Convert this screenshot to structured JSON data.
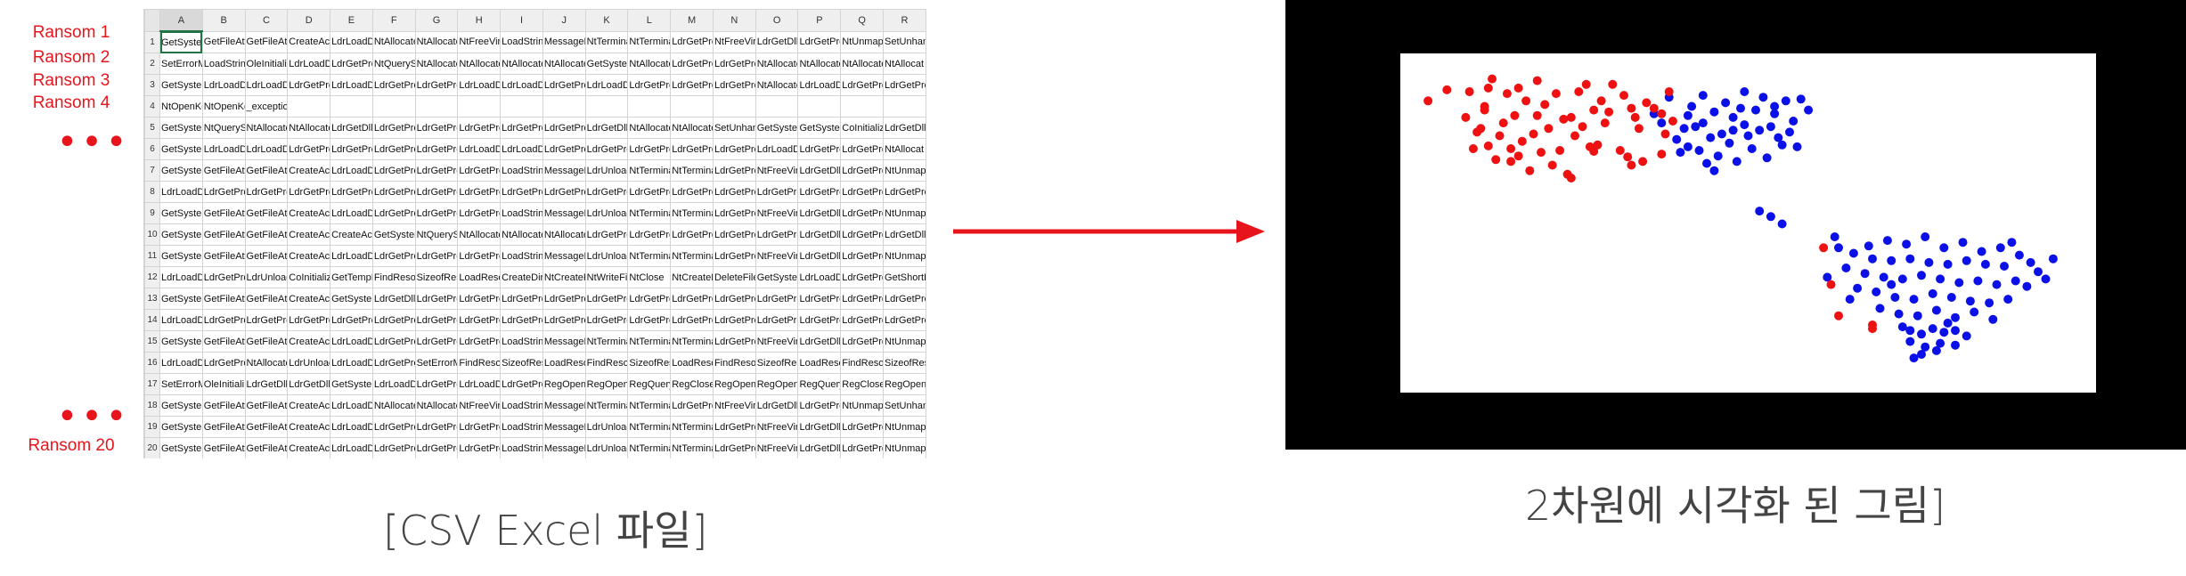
{
  "labels": {
    "ransom1": "Ransom 1",
    "ransom2": "Ransom 2",
    "ransom3": "Ransom 3",
    "ransom4": "Ransom 4",
    "ransom20": "Ransom 20",
    "ellipsis": "•••"
  },
  "spreadsheet": {
    "columns": [
      "A",
      "B",
      "C",
      "D",
      "E",
      "F",
      "G",
      "H",
      "I",
      "J",
      "K",
      "L",
      "M",
      "N",
      "O",
      "P",
      "Q",
      "R"
    ],
    "rows": [
      {
        "n": "1",
        "cells": [
          "GetSystem",
          "GetFileAtt",
          "GetFileAtt",
          "CreateActi",
          "LdrLoadDl",
          "NtAllocate",
          "NtAllocate",
          "NtFreeVirt",
          "LoadString",
          "MessageB",
          "NtTermina",
          "NtTermina",
          "LdrGetPro",
          "NtFreeVirt",
          "LdrGetDllI",
          "LdrGetPro",
          "NtUnmapV",
          "SetUnhan"
        ]
      },
      {
        "n": "2",
        "cells": [
          "SetErrorM",
          "LoadString",
          "OleInitiali",
          "LdrLoadDl",
          "LdrGetPro",
          "NtQuerySy",
          "NtAllocate",
          "NtAllocate",
          "NtAllocate",
          "NtAllocate",
          "GetSystem",
          "NtAllocate",
          "LdrGetPro",
          "LdrGetPro",
          "NtAllocate",
          "NtAllocate",
          "NtAllocate",
          "NtAllocat"
        ]
      },
      {
        "n": "3",
        "cells": [
          "GetSystem",
          "LdrLoadDl",
          "LdrLoadDl",
          "LdrGetPro",
          "LdrLoadDl",
          "LdrGetPro",
          "LdrGetPro",
          "LdrLoadDl",
          "LdrLoadDl",
          "LdrGetPro",
          "LdrLoadDl",
          "LdrGetPro",
          "LdrGetPro",
          "LdrGetPro",
          "NtAllocate",
          "LdrLoadDl",
          "LdrGetPro",
          "LdrGetPro"
        ]
      },
      {
        "n": "4",
        "cells": [
          "NtOpenKe",
          "NtOpenKe",
          "_exception_",
          "",
          "",
          "",
          "",
          "",
          "",
          "",
          "",
          "",
          "",
          "",
          "",
          "",
          "",
          ""
        ]
      },
      {
        "n": "5",
        "cells": [
          "GetSystem",
          "NtQuerySy",
          "NtAllocate",
          "NtAllocate",
          "LdrGetDllI",
          "LdrGetPro",
          "LdrGetPro",
          "LdrGetPro",
          "LdrGetPro",
          "LdrGetPro",
          "LdrGetDllI",
          "NtAllocate",
          "NtAllocate",
          "SetUnhan",
          "GetSystem",
          "GetSystem",
          "CoInitializ",
          "LdrGetDllI"
        ]
      },
      {
        "n": "6",
        "cells": [
          "GetSystem",
          "LdrLoadDl",
          "LdrLoadDl",
          "LdrGetPro",
          "LdrGetPro",
          "LdrGetPro",
          "LdrGetPro",
          "LdrLoadDl",
          "LdrLoadDl",
          "LdrGetPro",
          "LdrGetPro",
          "LdrGetPro",
          "LdrGetPro",
          "LdrGetPro",
          "LdrLoadDl",
          "LdrGetPro",
          "LdrGetPro",
          "NtAllocat"
        ]
      },
      {
        "n": "7",
        "cells": [
          "GetSystem",
          "GetFileAtt",
          "GetFileAtt",
          "CreateActi",
          "LdrLoadDl",
          "LdrGetPro",
          "LdrGetPro",
          "LdrGetPro",
          "LoadString",
          "MessageB",
          "LdrUnloac",
          "NtTermina",
          "NtTermina",
          "LdrGetPro",
          "NtFreeVirt",
          "LdrGetDllI",
          "LdrGetPro",
          "NtUnmap"
        ]
      },
      {
        "n": "8",
        "cells": [
          "LdrLoadDl",
          "LdrGetPro",
          "LdrGetPro",
          "LdrGetPro",
          "LdrGetPro",
          "LdrGetPro",
          "LdrGetPro",
          "LdrGetPro",
          "LdrGetPro",
          "LdrGetPro",
          "LdrGetPro",
          "LdrGetPro",
          "LdrGetPro",
          "LdrGetPro",
          "LdrGetPro",
          "LdrGetPro",
          "LdrGetPro",
          "LdrGetPro"
        ]
      },
      {
        "n": "9",
        "cells": [
          "GetSystem",
          "GetFileAtt",
          "GetFileAtt",
          "CreateActi",
          "LdrLoadDl",
          "LdrGetPro",
          "LdrGetPro",
          "LdrGetPro",
          "LoadString",
          "MessageB",
          "LdrUnloac",
          "NtTermina",
          "NtTermina",
          "LdrGetPro",
          "NtFreeVirt",
          "LdrGetDllI",
          "LdrGetPro",
          "NtUnmap"
        ]
      },
      {
        "n": "10",
        "cells": [
          "GetSystem",
          "GetFileAtt",
          "GetFileAtt",
          "CreateActi",
          "CreateActi",
          "GetSystem",
          "NtQuerySy",
          "NtAllocate",
          "NtAllocate",
          "NtAllocate",
          "LdrGetPro",
          "LdrGetPro",
          "LdrGetPro",
          "LdrGetPro",
          "LdrGetPro",
          "LdrGetDllI",
          "LdrGetPro",
          "LdrGetDllI"
        ]
      },
      {
        "n": "11",
        "cells": [
          "GetSystem",
          "GetFileAtt",
          "GetFileAtt",
          "CreateActi",
          "LdrLoadDl",
          "LdrGetPro",
          "LdrGetPro",
          "LdrGetPro",
          "LoadString",
          "MessageB",
          "LdrUnloac",
          "NtTermina",
          "NtTermina",
          "LdrGetPro",
          "NtFreeVirt",
          "LdrGetDllI",
          "LdrGetPro",
          "NtUnmap"
        ]
      },
      {
        "n": "12",
        "cells": [
          "LdrLoadDl",
          "LdrGetPro",
          "LdrUnloac",
          "CoInitializ",
          "GetTempF",
          "FindResou",
          "SizeofResc",
          "LoadResou",
          "CreateDire",
          "NtCreateF",
          "NtWriteFil",
          "NtClose",
          "NtCreateF",
          "DeleteFile",
          "GetSystem",
          "LdrLoadDl",
          "LdrGetPro",
          "GetShortI"
        ]
      },
      {
        "n": "13",
        "cells": [
          "GetSystem",
          "GetFileAtt",
          "GetFileAtt",
          "CreateActi",
          "GetSystem",
          "LdrGetDllI",
          "LdrGetPro",
          "LdrGetPro",
          "LdrGetPro",
          "LdrGetPro",
          "LdrGetPro",
          "LdrGetPro",
          "LdrGetPro",
          "LdrGetPro",
          "LdrGetPro",
          "LdrGetPro",
          "LdrGetPro",
          "LdrGetPro"
        ]
      },
      {
        "n": "14",
        "cells": [
          "LdrLoadDl",
          "LdrGetPro",
          "LdrGetPro",
          "LdrGetPro",
          "LdrGetPro",
          "LdrGetPro",
          "LdrGetPro",
          "LdrGetPro",
          "LdrGetPro",
          "LdrGetPro",
          "LdrGetPro",
          "LdrGetPro",
          "LdrGetPro",
          "LdrGetPro",
          "LdrGetPro",
          "LdrGetPro",
          "LdrGetPro",
          "LdrGetPro"
        ]
      },
      {
        "n": "15",
        "cells": [
          "GetSystem",
          "GetFileAtt",
          "GetFileAtt",
          "CreateActi",
          "LdrLoadDl",
          "LdrGetPro",
          "LdrGetPro",
          "LdrGetPro",
          "LoadString",
          "MessageB",
          "NtTermina",
          "NtTermina",
          "NtTermina",
          "LdrGetPro",
          "NtFreeVirt",
          "LdrGetDllI",
          "LdrGetPro",
          "NtUnmap"
        ]
      },
      {
        "n": "16",
        "cells": [
          "LdrLoadDl",
          "LdrGetPro",
          "NtAllocate",
          "LdrUnloac",
          "LdrLoadDl",
          "LdrGetPro",
          "SetErrorM",
          "FindResou",
          "SizeofResc",
          "LoadResou",
          "FindResou",
          "SizeofResc",
          "LoadResou",
          "FindResou",
          "SizeofResc",
          "LoadResou",
          "FindResou",
          "SizeofRes"
        ]
      },
      {
        "n": "17",
        "cells": [
          "SetErrorM",
          "OleInitiali",
          "LdrGetDllI",
          "LdrGetDllI",
          "GetSystem",
          "LdrLoadDl",
          "LdrGetPro",
          "LdrLoadDl",
          "LdrGetPro",
          "RegOpenK",
          "RegOpenK",
          "RegQuery",
          "RegCloseK",
          "RegOpenK",
          "RegOpenK",
          "RegQuery",
          "RegCloseK",
          "RegOpen"
        ]
      },
      {
        "n": "18",
        "cells": [
          "GetSystem",
          "GetFileAtt",
          "GetFileAtt",
          "CreateActi",
          "LdrLoadDl",
          "NtAllocate",
          "NtAllocate",
          "NtFreeVirt",
          "LoadString",
          "MessageB",
          "NtTermina",
          "NtTermina",
          "LdrGetPro",
          "NtFreeVirt",
          "LdrGetDllI",
          "LdrGetPro",
          "NtUnmapV",
          "SetUnhan"
        ]
      },
      {
        "n": "19",
        "cells": [
          "GetSystem",
          "GetFileAtt",
          "GetFileAtt",
          "CreateActi",
          "LdrLoadDl",
          "LdrGetPro",
          "LdrGetPro",
          "LdrGetPro",
          "LoadString",
          "MessageB",
          "LdrUnloac",
          "NtTermina",
          "NtTermina",
          "LdrGetPro",
          "NtFreeVirt",
          "LdrGetDllI",
          "LdrGetPro",
          "NtUnmap"
        ]
      },
      {
        "n": "20",
        "cells": [
          "GetSystem",
          "GetFileAtt",
          "GetFileAtt",
          "CreateActi",
          "LdrLoadDl",
          "LdrGetPro",
          "LdrGetPro",
          "LdrGetPro",
          "LoadString",
          "MessageB",
          "LdrUnloac",
          "NtTermina",
          "NtTermina",
          "LdrGetPro",
          "NtFreeVirt",
          "LdrGetDllI",
          "LdrGetPro",
          "NtUnmap"
        ]
      }
    ]
  },
  "captions": {
    "left": "[CSV Excel 파일]",
    "right": "2차원에 시각화 된 그림]"
  },
  "colors": {
    "label_red": "#e8141b",
    "arrow_red": "#e8141b",
    "point_red": "#ee1111",
    "point_blue": "#0a10e6",
    "plot_frame": "#000000"
  },
  "scatter": {
    "red": [
      [
        2,
        -0.2
      ],
      [
        6,
        -0.05
      ],
      [
        5,
        2.1
      ],
      [
        12,
        -0.9
      ],
      [
        8,
        -0.8
      ],
      [
        19,
        1.6
      ],
      [
        28,
        1.5
      ],
      [
        33,
        -0.1
      ],
      [
        44,
        -1.1
      ],
      [
        53,
        0.6
      ],
      [
        44,
        2.0
      ],
      [
        54,
        2.9
      ],
      [
        39,
        3.3
      ],
      [
        24,
        2.8
      ],
      [
        14,
        -0.6
      ],
      [
        16,
        2.4
      ],
      [
        36,
        2.4
      ],
      [
        48,
        2.3
      ],
      [
        55,
        1.3
      ],
      [
        34,
        -0.35
      ],
      [
        26,
        1.4
      ],
      [
        14,
        3.1
      ],
      [
        43,
        -0.65
      ],
      [
        29,
        0.5
      ],
      [
        38,
        1.8
      ],
      [
        10,
        1.2
      ],
      [
        20,
        -0.4
      ],
      [
        5,
        1.9
      ],
      [
        30,
        2.9
      ],
      [
        22,
        0.9
      ],
      [
        52,
        -0.5
      ],
      [
        27,
        -1.6
      ],
      [
        9,
        0.5
      ],
      [
        15,
        0.2
      ],
      [
        46,
        0.9
      ],
      [
        35,
        0.0
      ],
      [
        41,
        -0.3
      ],
      [
        17,
        -1.4
      ],
      [
        31,
        1.0
      ],
      [
        50,
        2.0
      ],
      [
        1,
        2.9
      ],
      [
        7,
        3.6
      ],
      [
        12,
        -0.2
      ],
      [
        25,
        -0.3
      ],
      [
        3,
        0.7
      ],
      [
        21,
        2.2
      ],
      [
        19,
        3.5
      ],
      [
        32,
        3.3
      ],
      [
        37,
        1.2
      ],
      [
        45,
        1.5
      ],
      [
        18,
        0.6
      ],
      [
        23,
        -1.1
      ],
      [
        42,
        2.7
      ],
      [
        47,
        -0.9
      ],
      [
        52,
        1.7
      ],
      [
        11,
        2.8
      ],
      [
        6,
        3.1
      ],
      [
        -5,
        3.0
      ],
      [
        -10,
        2.4
      ],
      [
        0,
        1.5
      ],
      [
        4,
        0.9
      ],
      [
        13,
        1.6
      ],
      [
        34,
        1.9
      ],
      [
        28,
        -1.8
      ],
      [
        97,
        -7.6
      ],
      [
        99,
        -9.3
      ],
      [
        95,
        -5.6
      ],
      [
        108,
        -9.8
      ],
      [
        108,
        -10.0
      ]
    ],
    "blue": [
      [
        63,
        1.2
      ],
      [
        68,
        0.6
      ],
      [
        74,
        1.1
      ],
      [
        81,
        1.0
      ],
      [
        86,
        0.7
      ],
      [
        58,
        0.9
      ],
      [
        70,
        0.1
      ],
      [
        76,
        -0.2
      ],
      [
        84,
        0.0
      ],
      [
        62,
        -0.3
      ],
      [
        66,
        1.8
      ],
      [
        73,
        2.0
      ],
      [
        79,
        2.6
      ],
      [
        85,
        2.4
      ],
      [
        89,
        2.5
      ],
      [
        59,
        1.6
      ],
      [
        65,
        0.4
      ],
      [
        71,
        1.5
      ],
      [
        77,
        1.9
      ],
      [
        82,
        1.7
      ],
      [
        56,
        0.3
      ],
      [
        61,
        1.0
      ],
      [
        67,
        -0.6
      ],
      [
        75,
        0.5
      ],
      [
        80,
        -0.7
      ],
      [
        88,
        -0.1
      ],
      [
        52,
        1.2
      ],
      [
        57,
        -0.4
      ],
      [
        69,
        2.3
      ],
      [
        78,
        0.8
      ],
      [
        60,
        2.1
      ],
      [
        64,
        -1.0
      ],
      [
        72,
        -0.9
      ],
      [
        83,
        0.4
      ],
      [
        87,
        1.3
      ],
      [
        54,
        2.6
      ],
      [
        50,
        1.7
      ],
      [
        63,
        2.7
      ],
      [
        74,
        2.9
      ],
      [
        66,
        -1.4
      ],
      [
        71,
        0.8
      ],
      [
        82,
        2.1
      ],
      [
        91,
        1.9
      ],
      [
        59,
        -0.1
      ],
      [
        78,
        -3.6
      ],
      [
        81,
        -3.9
      ],
      [
        84,
        -4.3
      ],
      [
        99,
        -5.6
      ],
      [
        103,
        -5.9
      ],
      [
        108,
        -6.2
      ],
      [
        113,
        -6.3
      ],
      [
        118,
        -6.2
      ],
      [
        123,
        -6.4
      ],
      [
        128,
        -6.5
      ],
      [
        133,
        -6.3
      ],
      [
        138,
        -6.5
      ],
      [
        143,
        -6.6
      ],
      [
        101,
        -6.7
      ],
      [
        106,
        -7.0
      ],
      [
        111,
        -7.2
      ],
      [
        116,
        -7.3
      ],
      [
        121,
        -7.1
      ],
      [
        126,
        -7.3
      ],
      [
        131,
        -7.5
      ],
      [
        136,
        -7.4
      ],
      [
        141,
        -7.6
      ],
      [
        146,
        -7.4
      ],
      [
        104,
        -7.8
      ],
      [
        109,
        -8.0
      ],
      [
        114,
        -8.3
      ],
      [
        119,
        -8.4
      ],
      [
        124,
        -8.1
      ],
      [
        129,
        -8.3
      ],
      [
        134,
        -8.5
      ],
      [
        139,
        -8.6
      ],
      [
        144,
        -8.4
      ],
      [
        149,
        -7.7
      ],
      [
        107,
        -5.5
      ],
      [
        112,
        -5.2
      ],
      [
        117,
        -5.4
      ],
      [
        122,
        -5.0
      ],
      [
        127,
        -5.6
      ],
      [
        132,
        -5.3
      ],
      [
        137,
        -5.8
      ],
      [
        142,
        -5.6
      ],
      [
        147,
        -6.0
      ],
      [
        152,
        -6.9
      ],
      [
        110,
        -8.9
      ],
      [
        115,
        -9.2
      ],
      [
        120,
        -9.3
      ],
      [
        125,
        -9.0
      ],
      [
        130,
        -9.4
      ],
      [
        135,
        -9.1
      ],
      [
        140,
        -9.5
      ],
      [
        96,
        -7.2
      ],
      [
        98,
        -5.0
      ],
      [
        150,
        -6.4
      ],
      [
        118,
        -10.1
      ],
      [
        121,
        -10.3
      ],
      [
        124,
        -10.0
      ],
      [
        127,
        -10.2
      ],
      [
        130,
        -10.1
      ],
      [
        133,
        -10.4
      ],
      [
        118,
        -10.7
      ],
      [
        122,
        -11.0
      ],
      [
        126,
        -10.8
      ],
      [
        130,
        -10.9
      ],
      [
        121,
        -11.4
      ],
      [
        125,
        -11.2
      ],
      [
        128,
        -9.7
      ],
      [
        116,
        -9.9
      ],
      [
        119,
        -11.6
      ],
      [
        154,
        -7.3
      ],
      [
        156,
        -6.2
      ],
      [
        102,
        -8.4
      ],
      [
        113,
        -7.6
      ],
      [
        145,
        -5.3
      ]
    ],
    "xlim": [
      -15,
      165
    ],
    "ylim": [
      -13,
      4.5
    ]
  }
}
